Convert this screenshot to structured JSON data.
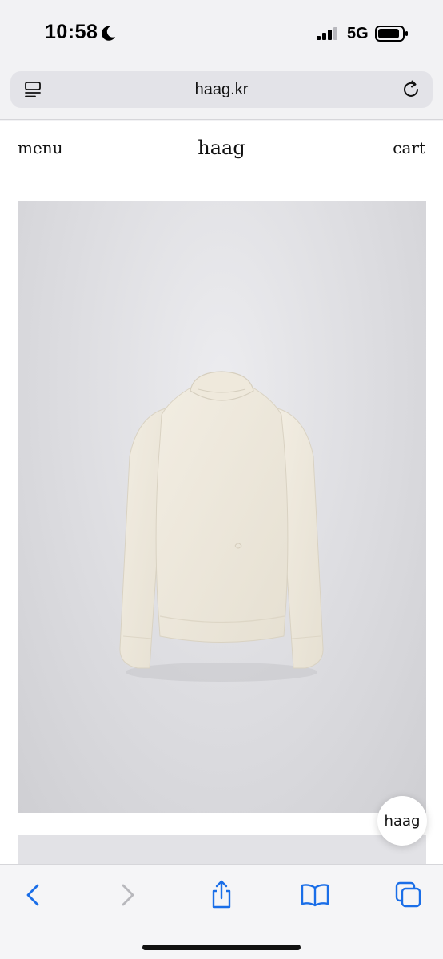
{
  "status_bar": {
    "time": "10:58",
    "network": "5G",
    "icons": [
      "moon-icon",
      "signal-icon",
      "battery-icon"
    ]
  },
  "address_bar": {
    "url": "haag.kr",
    "icons": [
      "reader-icon",
      "reload-icon"
    ]
  },
  "site_nav": {
    "menu_label": "menu",
    "logo": "haag",
    "cart_label": "cart"
  },
  "product": {
    "image_description_icon": "sweater-image"
  },
  "chat_button": {
    "label": "haag"
  },
  "toolbar": {
    "icons": [
      "back-icon",
      "forward-icon",
      "share-icon",
      "bookmarks-icon",
      "tabs-icon"
    ]
  },
  "colors": {
    "accent": "#1a6ee8",
    "disabled": "#b8b8bd",
    "page_bg": "#ffffff",
    "chrome_bg": "#f2f2f4"
  }
}
